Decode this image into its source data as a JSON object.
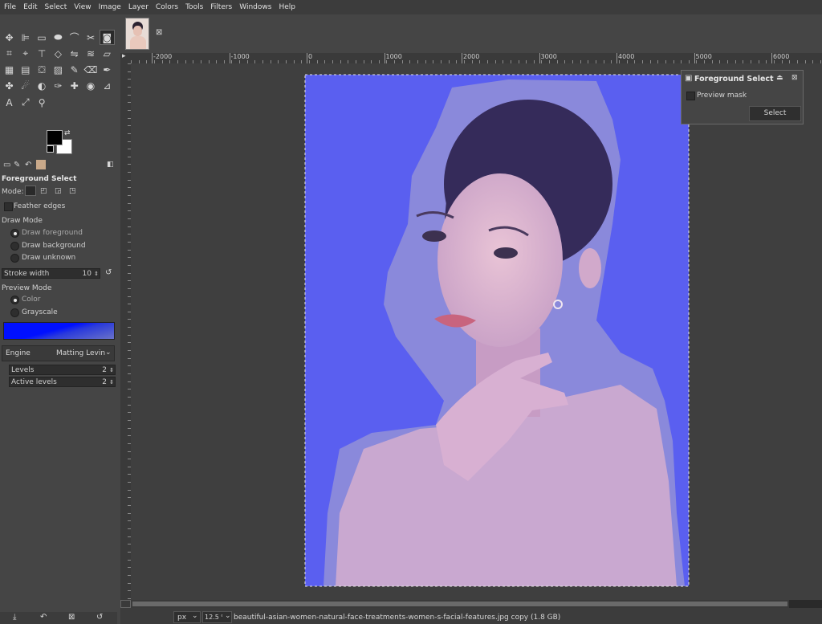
{
  "menu": [
    "File",
    "Edit",
    "Select",
    "View",
    "Image",
    "Layer",
    "Colors",
    "Tools",
    "Filters",
    "Windows",
    "Help"
  ],
  "toolbox": {
    "tools_row1": [
      "move-icon",
      "align-icon",
      "rect-select-icon",
      "ellipse-select-icon",
      "free-select-icon",
      "scissors-select-icon",
      "foreground-select-icon"
    ],
    "tools_row2": [
      "crop-icon",
      "paths-icon",
      "transform-icon",
      "perspective-icon",
      "flip-icon",
      "warp-icon",
      "shear-icon"
    ],
    "tools_row3": [
      "cage-icon",
      "wrap-icon",
      "bucket-icon",
      "gradient-icon",
      "paint-icon",
      "eraser-icon",
      "airbrush-icon"
    ],
    "tools_row4": [
      "clone-icon",
      "smudge-icon",
      "dodge-icon",
      "ink-icon",
      "heal-icon",
      "color-picker-icon",
      "measure-icon"
    ],
    "tools_row5": [
      "text-icon",
      "eyedropper-icon",
      "zoom-icon"
    ]
  },
  "options": {
    "title": "Foreground Select",
    "mode_label": "Mode:",
    "feather_edges": "Feather edges",
    "draw_mode_label": "Draw Mode",
    "draw_foreground": "Draw foreground",
    "draw_background": "Draw background",
    "draw_unknown": "Draw unknown",
    "stroke_width_label": "Stroke width",
    "stroke_width_value": "10",
    "preview_mode_label": "Preview Mode",
    "preview_color": "Color",
    "preview_grayscale": "Grayscale",
    "engine_label": "Engine",
    "engine_value": "Matting Levin",
    "levels_label": "Levels",
    "levels_value": "2",
    "active_levels_label": "Active levels",
    "active_levels_value": "2"
  },
  "ruler": {
    "labels": [
      "-2000",
      "-1000",
      "0",
      "1000",
      "2000",
      "3000",
      "4000",
      "5000",
      "6000"
    ]
  },
  "fg_dialog": {
    "title": "Foreground Select",
    "preview_mask": "Preview mask",
    "select_button": "Select"
  },
  "status": {
    "unit": "px",
    "zoom": "12.5 %",
    "filename": "beautiful-asian-women-natural-face-treatments-women-s-facial-features.jpg copy (1.8 GB)"
  },
  "colors": {
    "overlay": "#5a5ff0",
    "foreground": "#000000",
    "background": "#ffffff"
  }
}
